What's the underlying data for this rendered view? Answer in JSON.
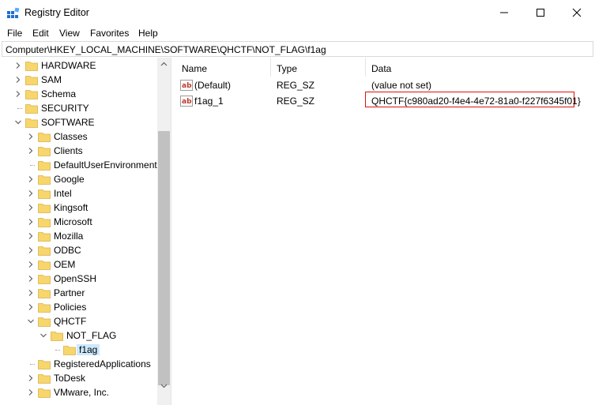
{
  "window": {
    "title": "Registry Editor",
    "icon": "registry-editor-icon",
    "accent": "#0078d7"
  },
  "menu": [
    "File",
    "Edit",
    "View",
    "Favorites",
    "Help"
  ],
  "address": "Computer\\HKEY_LOCAL_MACHINE\\SOFTWARE\\QHCTF\\NOT_FLAG\\f1ag",
  "tree": [
    {
      "label": "HARDWARE",
      "level": 1,
      "expander": "collapsed"
    },
    {
      "label": "SAM",
      "level": 1,
      "expander": "collapsed"
    },
    {
      "label": "Schema",
      "level": 1,
      "expander": "collapsed"
    },
    {
      "label": "SECURITY",
      "level": 1,
      "expander": "none"
    },
    {
      "label": "SOFTWARE",
      "level": 1,
      "expander": "expanded"
    },
    {
      "label": "Classes",
      "level": 2,
      "expander": "collapsed"
    },
    {
      "label": "Clients",
      "level": 2,
      "expander": "collapsed"
    },
    {
      "label": "DefaultUserEnvironment",
      "level": 2,
      "expander": "none"
    },
    {
      "label": "Google",
      "level": 2,
      "expander": "collapsed"
    },
    {
      "label": "Intel",
      "level": 2,
      "expander": "collapsed"
    },
    {
      "label": "Kingsoft",
      "level": 2,
      "expander": "collapsed"
    },
    {
      "label": "Microsoft",
      "level": 2,
      "expander": "collapsed"
    },
    {
      "label": "Mozilla",
      "level": 2,
      "expander": "collapsed"
    },
    {
      "label": "ODBC",
      "level": 2,
      "expander": "collapsed"
    },
    {
      "label": "OEM",
      "level": 2,
      "expander": "collapsed"
    },
    {
      "label": "OpenSSH",
      "level": 2,
      "expander": "collapsed"
    },
    {
      "label": "Partner",
      "level": 2,
      "expander": "collapsed"
    },
    {
      "label": "Policies",
      "level": 2,
      "expander": "collapsed"
    },
    {
      "label": "QHCTF",
      "level": 2,
      "expander": "expanded"
    },
    {
      "label": "NOT_FLAG",
      "level": 3,
      "expander": "expanded"
    },
    {
      "label": "f1ag",
      "level": 4,
      "expander": "none",
      "selected": true
    },
    {
      "label": "RegisteredApplications",
      "level": 2,
      "expander": "none"
    },
    {
      "label": "ToDesk",
      "level": 2,
      "expander": "collapsed"
    },
    {
      "label": "VMware, Inc.",
      "level": 2,
      "expander": "collapsed"
    }
  ],
  "list": {
    "columns": [
      "Name",
      "Type",
      "Data"
    ],
    "rows": [
      {
        "name": "(Default)",
        "type": "REG_SZ",
        "data": "(value not set)",
        "icon": "string-value-icon"
      },
      {
        "name": "f1ag_1",
        "type": "REG_SZ",
        "data": "QHCTF{c980ad20-f4e4-4e72-81a0-f227f6345f01}",
        "icon": "string-value-icon",
        "highlighted": true
      }
    ]
  },
  "colors": {
    "folder": "#f7d66b",
    "selection": "#cce8ff",
    "highlight_border": "#e01010"
  }
}
